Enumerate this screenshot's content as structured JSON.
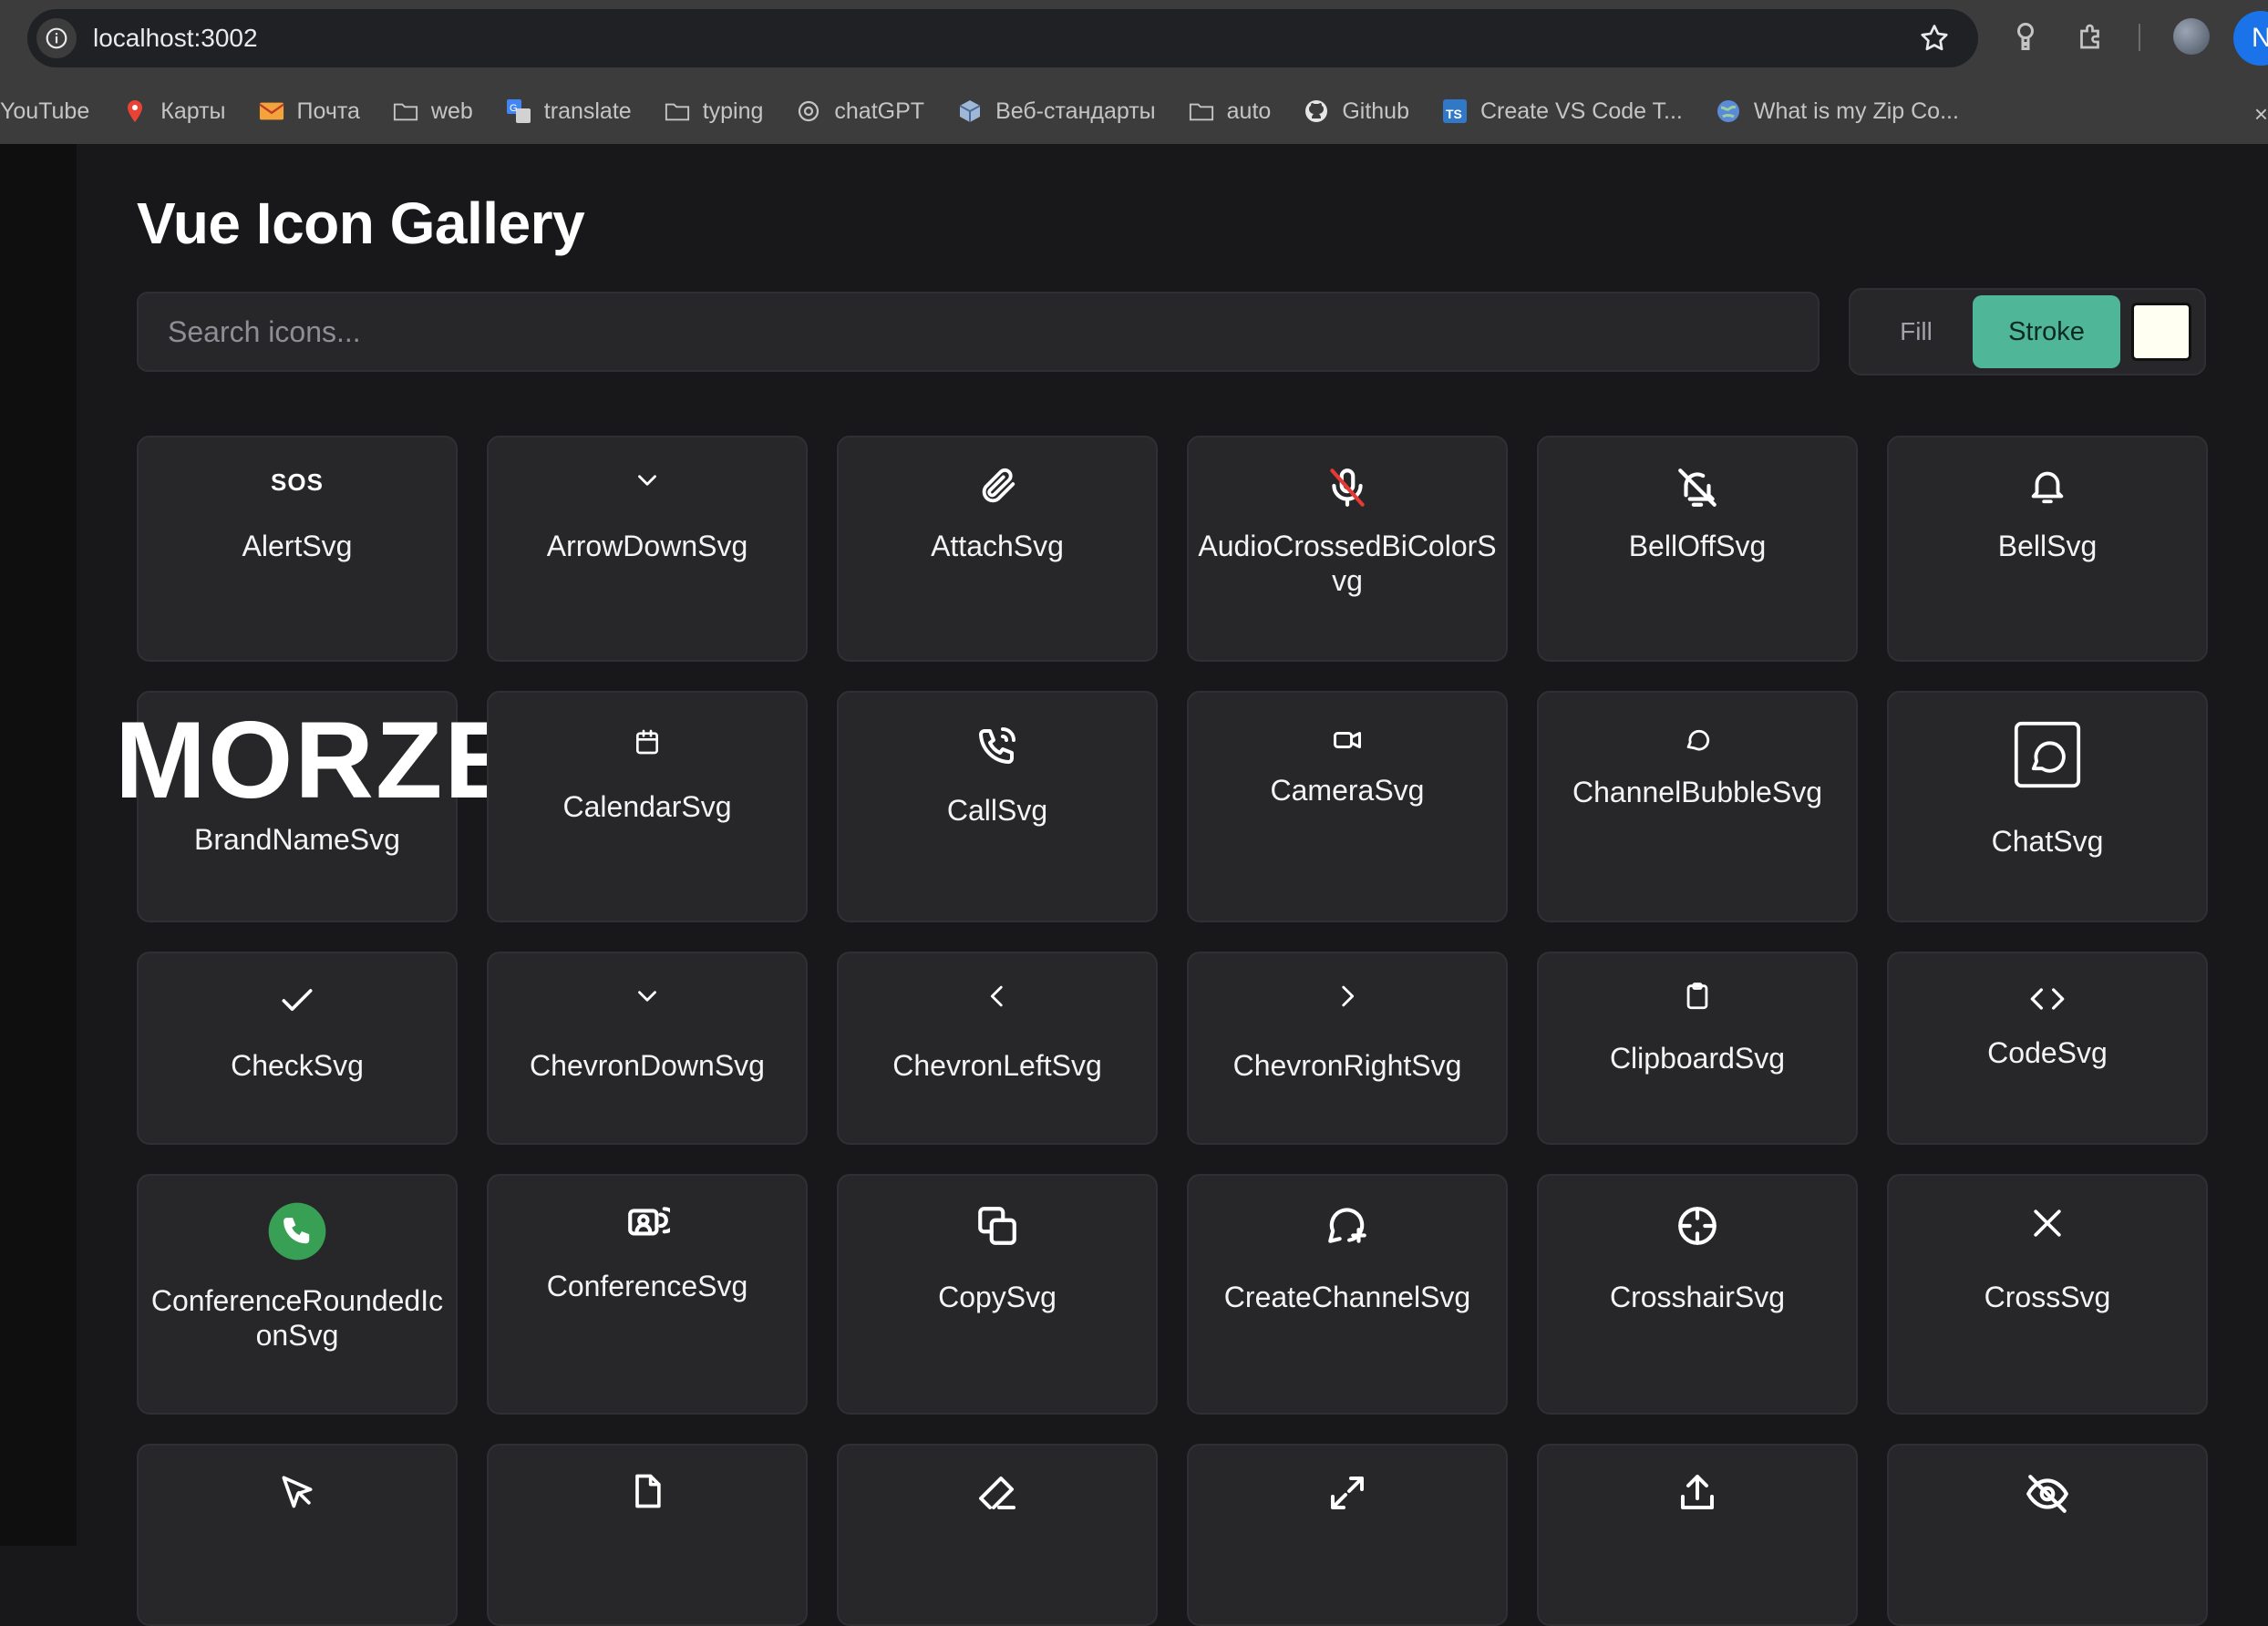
{
  "browser": {
    "url": "localhost:3002",
    "bookmarks": [
      {
        "label": "YouTube",
        "icon": "youtube-icon"
      },
      {
        "label": "Карты",
        "icon": "maps-pin-icon"
      },
      {
        "label": "Почта",
        "icon": "mail-icon"
      },
      {
        "label": "web",
        "icon": "folder-icon"
      },
      {
        "label": "translate",
        "icon": "translate-icon"
      },
      {
        "label": "typing",
        "icon": "folder-icon"
      },
      {
        "label": "chatGPT",
        "icon": "openai-icon"
      },
      {
        "label": "Веб-стандарты",
        "icon": "cube-icon"
      },
      {
        "label": "auto",
        "icon": "folder-icon"
      },
      {
        "label": "Github",
        "icon": "github-icon"
      },
      {
        "label": "Create VS Code T...",
        "icon": "typescript-icon"
      },
      {
        "label": "What is my Zip Co...",
        "icon": "globe-icon"
      }
    ],
    "profile_initial": "N",
    "overflow_symbol": "×"
  },
  "page": {
    "title": "Vue Icon Gallery",
    "search_placeholder": "Search icons...",
    "mode": {
      "fill_label": "Fill",
      "stroke_label": "Stroke",
      "active": "Stroke"
    },
    "color_swatch": "#fffff2",
    "accent": "#4fb697"
  },
  "icons": [
    {
      "name": "AlertSvg",
      "icon": "sos-icon",
      "glyph": "SOS"
    },
    {
      "name": "ArrowDownSvg",
      "icon": "arrow-down-icon"
    },
    {
      "name": "AttachSvg",
      "icon": "paperclip-icon"
    },
    {
      "name": "AudioCrossedBiColorSvg",
      "icon": "microphone-crossed-icon"
    },
    {
      "name": "BellOffSvg",
      "icon": "bell-off-icon"
    },
    {
      "name": "BellSvg",
      "icon": "bell-icon"
    },
    {
      "name": "BrandNameSvg",
      "icon": "brand-name-icon",
      "glyph": "MORZE"
    },
    {
      "name": "CalendarSvg",
      "icon": "calendar-icon"
    },
    {
      "name": "CallSvg",
      "icon": "phone-call-icon"
    },
    {
      "name": "CameraSvg",
      "icon": "video-camera-icon"
    },
    {
      "name": "ChannelBubbleSvg",
      "icon": "speech-bubble-icon"
    },
    {
      "name": "ChatSvg",
      "icon": "chat-icon"
    },
    {
      "name": "CheckSvg",
      "icon": "check-icon"
    },
    {
      "name": "ChevronDownSvg",
      "icon": "chevron-down-icon"
    },
    {
      "name": "ChevronLeftSvg",
      "icon": "chevron-left-icon"
    },
    {
      "name": "ChevronRightSvg",
      "icon": "chevron-right-icon"
    },
    {
      "name": "ClipboardSvg",
      "icon": "clipboard-icon"
    },
    {
      "name": "CodeSvg",
      "icon": "code-icon"
    },
    {
      "name": "ConferenceRoundedIconSvg",
      "icon": "phone-rounded-icon"
    },
    {
      "name": "ConferenceSvg",
      "icon": "conference-icon"
    },
    {
      "name": "CopySvg",
      "icon": "copy-icon"
    },
    {
      "name": "CreateChannelSvg",
      "icon": "create-channel-icon"
    },
    {
      "name": "CrosshairSvg",
      "icon": "crosshair-icon"
    },
    {
      "name": "CrossSvg",
      "icon": "close-icon"
    },
    {
      "name": "",
      "icon": "cursor-icon"
    },
    {
      "name": "",
      "icon": "file-icon"
    },
    {
      "name": "",
      "icon": "eraser-icon"
    },
    {
      "name": "",
      "icon": "expand-icon"
    },
    {
      "name": "",
      "icon": "upload-icon"
    },
    {
      "name": "",
      "icon": "eye-off-icon"
    }
  ]
}
